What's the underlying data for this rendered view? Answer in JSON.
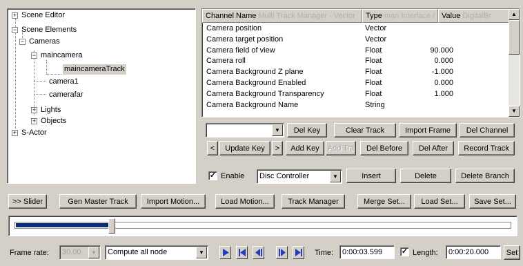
{
  "tree": {
    "items": [
      {
        "label": "Scene Editor",
        "expander": "+"
      },
      {
        "label": "Scene Elements",
        "expander": "−"
      },
      {
        "label": "Cameras",
        "expander": "−"
      },
      {
        "label": "maincamera",
        "expander": "−"
      },
      {
        "label": "maincameraTrack",
        "selected": true
      },
      {
        "label": "camera1"
      },
      {
        "label": "camerafar"
      },
      {
        "label": "Lights",
        "expander": "+"
      },
      {
        "label": "Objects",
        "expander": "+"
      },
      {
        "label": "S-Actor",
        "expander": "+"
      }
    ]
  },
  "grid": {
    "headers": {
      "channel": "Channel Name",
      "channel_ghost": "Multi Track Manager - Vector",
      "type": "Type",
      "type_ghost": "man Interface / ",
      "value": "Value",
      "value_ghost": "DigitalBr"
    },
    "rows": [
      {
        "name": "Camera position",
        "type": "Vector",
        "value": ""
      },
      {
        "name": "Camera target position",
        "type": "Vector",
        "value": ""
      },
      {
        "name": "Camera field of view",
        "type": "Float",
        "value": "90.000"
      },
      {
        "name": "Camera roll",
        "type": "Float",
        "value": "0.000"
      },
      {
        "name": "Camera Background Z plane",
        "type": "Float",
        "value": "-1.000"
      },
      {
        "name": "Camera Background Enabled",
        "type": "Float",
        "value": "0.000"
      },
      {
        "name": "Camera Background Transparency",
        "type": "Float",
        "value": "1.000"
      },
      {
        "name": "Camera Background Name",
        "type": "String",
        "value": ""
      }
    ]
  },
  "track_controls": {
    "key_combo_value": "",
    "del_key": "Del Key",
    "clear_track": "Clear Track",
    "import_frame": "Import Frame",
    "del_channel": "Del Channel",
    "prev": "<",
    "update_key": "Update Key",
    "next": ">",
    "add_key": "Add Key",
    "add_track": "Add Tra",
    "del_before": "Del Before",
    "del_after": "Del After",
    "record_track": "Record Track",
    "enable_label": "Enable",
    "enable_checked": "✓",
    "controller_value": "Disc Controller",
    "insert": "Insert",
    "delete": "Delete",
    "delete_branch": "Delete Branch"
  },
  "toolbar": {
    "slider": ">> Slider",
    "gen_master_track": "Gen Master Track",
    "import_motion": "Import Motion...",
    "load_motion": "Load Motion...",
    "track_manager": "Track Manager",
    "merge_set": "Merge Set...",
    "load_set": "Load Set...",
    "save_set": "Save Set..."
  },
  "timeline": {
    "position": 0.19
  },
  "status": {
    "frame_rate_label": "Frame rate:",
    "frame_rate_value": "30.00",
    "compute_value": "Compute all node",
    "time_label": "Time:",
    "time_value": "0:00:03.599",
    "length_checked": "✓",
    "length_label": "Length:",
    "length_value": "0:00:20.000",
    "set": "Set"
  },
  "colors": {
    "face": "#d4d0c8",
    "transport_blue": "#1f3fbf",
    "timeline_fill": "#0a2a7a"
  }
}
